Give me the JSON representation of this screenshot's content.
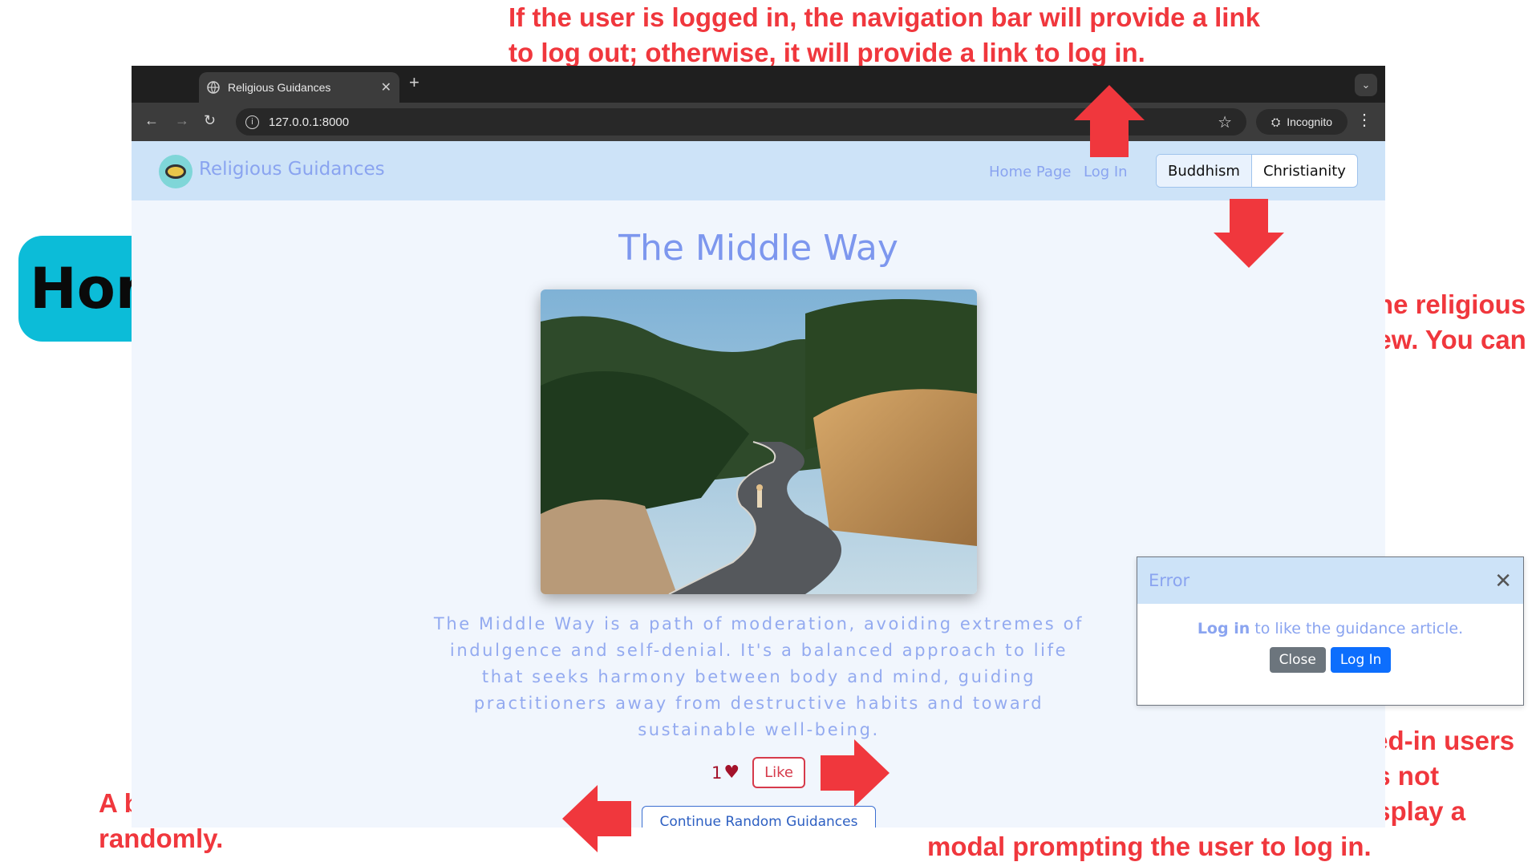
{
  "annotations": {
    "top": "If the user is logged in, the navigation bar will provide a link\nto log out; otherwise, it will provide a link to log in.",
    "group": "A group of buttons to select the religious\nguidance you would like to view. You can\nselect one religion at a time.",
    "like": "A button to like or unlike. Only logged-in users\ncan perform this action. If the user is not\nlogged in, clicking the button will display a\nmodal prompting the user to log in.",
    "random": "A button to generate new guidance\nrandomly.",
    "badge": "Home Page",
    "color": "#f0373d"
  },
  "browser": {
    "tab_title": "Religious Guidances",
    "url": "127.0.0.1:8000",
    "incognito_label": "Incognito",
    "icons": [
      "globe-icon",
      "close-icon",
      "plus-icon",
      "back-icon",
      "forward-icon",
      "reload-icon",
      "star-icon",
      "kebab-icon"
    ]
  },
  "site": {
    "brand": "Religious Guidances",
    "nav": {
      "home": "Home Page",
      "login": "Log In"
    },
    "religions": [
      "Buddhism",
      "Christianity"
    ],
    "active_religion": "Buddhism"
  },
  "article": {
    "title": "The Middle Way",
    "description": "The Middle Way is a path of moderation, avoiding extremes of indulgence and self-denial. It's a balanced approach to life that seeks harmony between body and mind, guiding practitioners away from destructive habits and toward sustainable well-being.",
    "like_count": "1",
    "like_label": "Like",
    "random_label": "Continue Random Guidances"
  },
  "modal": {
    "title": "Error",
    "message_bold": "Log in",
    "message_rest": " to like the guidance article.",
    "close_label": "Close",
    "login_label": "Log In"
  }
}
